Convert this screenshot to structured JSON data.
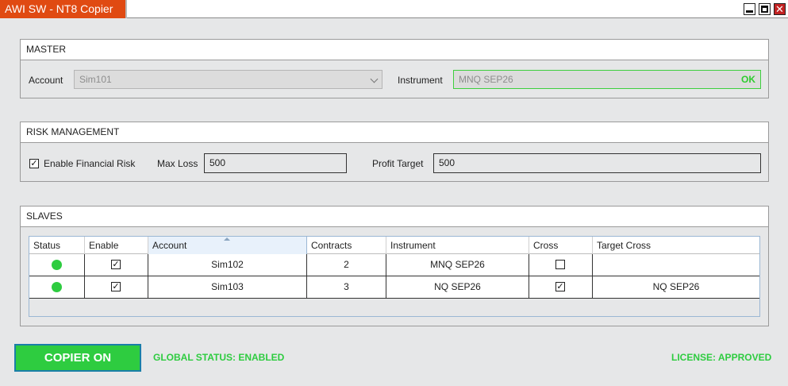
{
  "window": {
    "title": "AWI SW - NT8 Copier",
    "close_glyph": "✕"
  },
  "master": {
    "header": "MASTER",
    "account_label": "Account",
    "account_value": "Sim101",
    "instrument_label": "Instrument",
    "instrument_value": "MNQ SEP26",
    "instrument_status": "OK"
  },
  "risk": {
    "header": "RISK MANAGEMENT",
    "enable_label": "Enable Financial Risk",
    "enable_checked": true,
    "max_loss_label": "Max Loss",
    "max_loss_value": "500",
    "profit_target_label": "Profit Target",
    "profit_target_value": "500"
  },
  "slaves": {
    "header": "SLAVES",
    "columns": [
      "Status",
      "Enable",
      "Account",
      "Contracts",
      "Instrument",
      "Cross",
      "Target Cross"
    ],
    "rows": [
      {
        "status": "green",
        "enabled": "✓",
        "account": "Sim102",
        "contracts": "2",
        "instrument": "MNQ SEP26",
        "cross": "",
        "target_cross": ""
      },
      {
        "status": "green",
        "enabled": "✓",
        "account": "Sim103",
        "contracts": "3",
        "instrument": "NQ SEP26",
        "cross": "✓",
        "target_cross": "NQ SEP26"
      }
    ]
  },
  "footer": {
    "copier_button": "COPIER ON",
    "global_status": "GLOBAL STATUS: ENABLED",
    "license": "LICENSE: APPROVED"
  },
  "colors": {
    "title_accent": "#e04a12",
    "status_green": "#2ecc40",
    "button_border": "#1a7fa8"
  }
}
